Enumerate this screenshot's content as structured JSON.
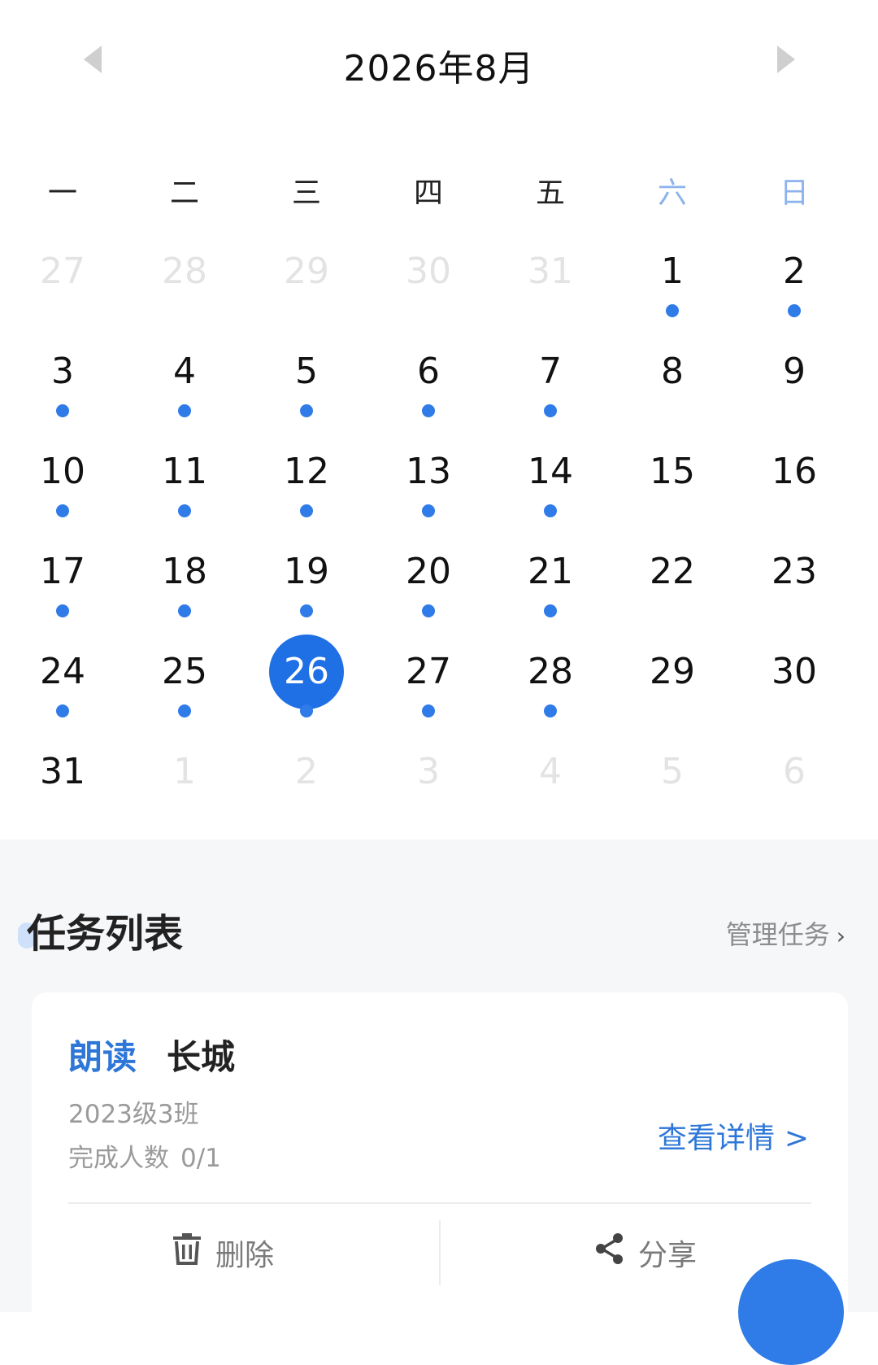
{
  "calendar": {
    "month_title": "2026年8月",
    "weekdays": [
      "一",
      "二",
      "三",
      "四",
      "五",
      "六",
      "日"
    ],
    "weeks": [
      [
        {
          "day": "27",
          "other": true,
          "dot": false
        },
        {
          "day": "28",
          "other": true,
          "dot": false
        },
        {
          "day": "29",
          "other": true,
          "dot": false
        },
        {
          "day": "30",
          "other": true,
          "dot": false
        },
        {
          "day": "31",
          "other": true,
          "dot": false
        },
        {
          "day": "1",
          "other": false,
          "dot": true
        },
        {
          "day": "2",
          "other": false,
          "dot": true
        }
      ],
      [
        {
          "day": "3",
          "other": false,
          "dot": true
        },
        {
          "day": "4",
          "other": false,
          "dot": true
        },
        {
          "day": "5",
          "other": false,
          "dot": true
        },
        {
          "day": "6",
          "other": false,
          "dot": true
        },
        {
          "day": "7",
          "other": false,
          "dot": true
        },
        {
          "day": "8",
          "other": false,
          "dot": false
        },
        {
          "day": "9",
          "other": false,
          "dot": false
        }
      ],
      [
        {
          "day": "10",
          "other": false,
          "dot": true
        },
        {
          "day": "11",
          "other": false,
          "dot": true
        },
        {
          "day": "12",
          "other": false,
          "dot": true
        },
        {
          "day": "13",
          "other": false,
          "dot": true
        },
        {
          "day": "14",
          "other": false,
          "dot": true
        },
        {
          "day": "15",
          "other": false,
          "dot": false
        },
        {
          "day": "16",
          "other": false,
          "dot": false
        }
      ],
      [
        {
          "day": "17",
          "other": false,
          "dot": true
        },
        {
          "day": "18",
          "other": false,
          "dot": true
        },
        {
          "day": "19",
          "other": false,
          "dot": true
        },
        {
          "day": "20",
          "other": false,
          "dot": true
        },
        {
          "day": "21",
          "other": false,
          "dot": true
        },
        {
          "day": "22",
          "other": false,
          "dot": false
        },
        {
          "day": "23",
          "other": false,
          "dot": false
        }
      ],
      [
        {
          "day": "24",
          "other": false,
          "dot": true
        },
        {
          "day": "25",
          "other": false,
          "dot": true
        },
        {
          "day": "26",
          "other": false,
          "dot": true,
          "selected": true
        },
        {
          "day": "27",
          "other": false,
          "dot": true
        },
        {
          "day": "28",
          "other": false,
          "dot": true
        },
        {
          "day": "29",
          "other": false,
          "dot": false
        },
        {
          "day": "30",
          "other": false,
          "dot": false
        }
      ],
      [
        {
          "day": "31",
          "other": false,
          "dot": false
        },
        {
          "day": "1",
          "other": true,
          "dot": false
        },
        {
          "day": "2",
          "other": true,
          "dot": false
        },
        {
          "day": "3",
          "other": true,
          "dot": false
        },
        {
          "day": "4",
          "other": true,
          "dot": false
        },
        {
          "day": "5",
          "other": true,
          "dot": false
        },
        {
          "day": "6",
          "other": true,
          "dot": false
        }
      ]
    ]
  },
  "tasks": {
    "title": "任务列表",
    "manage_label": "管理任务",
    "manage_chevron": "›",
    "card": {
      "type": "朗读",
      "name": "长城",
      "class_name": "2023级3班",
      "progress_label": "完成人数",
      "progress_value": "0/1",
      "detail_label": "查看详情",
      "detail_arrow": ">",
      "delete_label": "删除",
      "share_label": "分享"
    }
  },
  "colors": {
    "accent": "#1f6fe5",
    "dot": "#2f7be8",
    "weekend": "#8cb3ee",
    "link": "#2e77d8"
  }
}
